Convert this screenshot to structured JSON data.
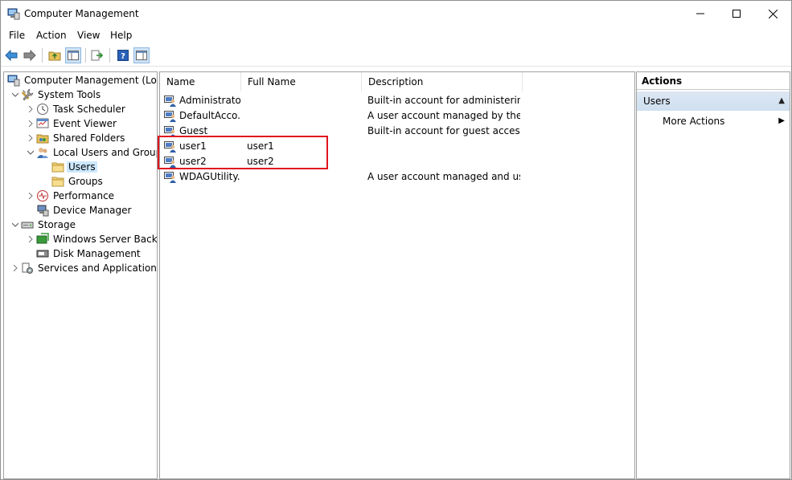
{
  "window": {
    "title": "Computer Management",
    "controls": {
      "minimize": "—",
      "maximize": "☐",
      "close": "✕"
    }
  },
  "menu": [
    "File",
    "Action",
    "View",
    "Help"
  ],
  "toolbar": {
    "icons": [
      "back-icon",
      "forward-icon",
      "up-folder-icon",
      "show-hide-tree-icon",
      "export-list-icon",
      "help-icon",
      "show-hide-action-pane-icon"
    ]
  },
  "tree": [
    {
      "label": "Computer Management (Local",
      "level": 0,
      "expander": "",
      "icon": "computer-management-icon"
    },
    {
      "label": "System Tools",
      "level": 1,
      "expander": "expanded",
      "icon": "system-tools-icon"
    },
    {
      "label": "Task Scheduler",
      "level": 2,
      "expander": "collapsed",
      "icon": "task-scheduler-icon"
    },
    {
      "label": "Event Viewer",
      "level": 2,
      "expander": "collapsed",
      "icon": "event-viewer-icon"
    },
    {
      "label": "Shared Folders",
      "level": 2,
      "expander": "collapsed",
      "icon": "shared-folders-icon"
    },
    {
      "label": "Local Users and Groups",
      "level": 2,
      "expander": "expanded",
      "icon": "local-users-groups-icon"
    },
    {
      "label": "Users",
      "level": 3,
      "expander": "",
      "icon": "folder-icon",
      "selected": true
    },
    {
      "label": "Groups",
      "level": 3,
      "expander": "",
      "icon": "folder-icon"
    },
    {
      "label": "Performance",
      "level": 2,
      "expander": "collapsed",
      "icon": "performance-icon"
    },
    {
      "label": "Device Manager",
      "level": 2,
      "expander": "",
      "icon": "device-manager-icon"
    },
    {
      "label": "Storage",
      "level": 1,
      "expander": "expanded",
      "icon": "storage-icon"
    },
    {
      "label": "Windows Server Backup",
      "level": 2,
      "expander": "collapsed",
      "icon": "windows-server-backup-icon"
    },
    {
      "label": "Disk Management",
      "level": 2,
      "expander": "",
      "icon": "disk-management-icon"
    },
    {
      "label": "Services and Applications",
      "level": 1,
      "expander": "collapsed",
      "icon": "services-applications-icon"
    }
  ],
  "list": {
    "columns": [
      "Name",
      "Full Name",
      "Description"
    ],
    "rows": [
      {
        "name": "Administrator",
        "full_name": "",
        "description": "Built-in account for administering..."
      },
      {
        "name": "DefaultAcco...",
        "full_name": "",
        "description": "A user account managed by the s..."
      },
      {
        "name": "Guest",
        "full_name": "",
        "description": "Built-in account for guest access t..."
      },
      {
        "name": "user1",
        "full_name": "user1",
        "description": ""
      },
      {
        "name": "user2",
        "full_name": "user2",
        "description": ""
      },
      {
        "name": "WDAGUtility...",
        "full_name": "",
        "description": "A user account managed and use..."
      }
    ]
  },
  "actions": {
    "header": "Actions",
    "group": "Users",
    "group_arrow": "▲",
    "items": [
      {
        "label": "More Actions",
        "arrow": "▶"
      }
    ]
  },
  "colors": {
    "highlight_box": "#e0141e",
    "selection": "#cce8ff"
  }
}
